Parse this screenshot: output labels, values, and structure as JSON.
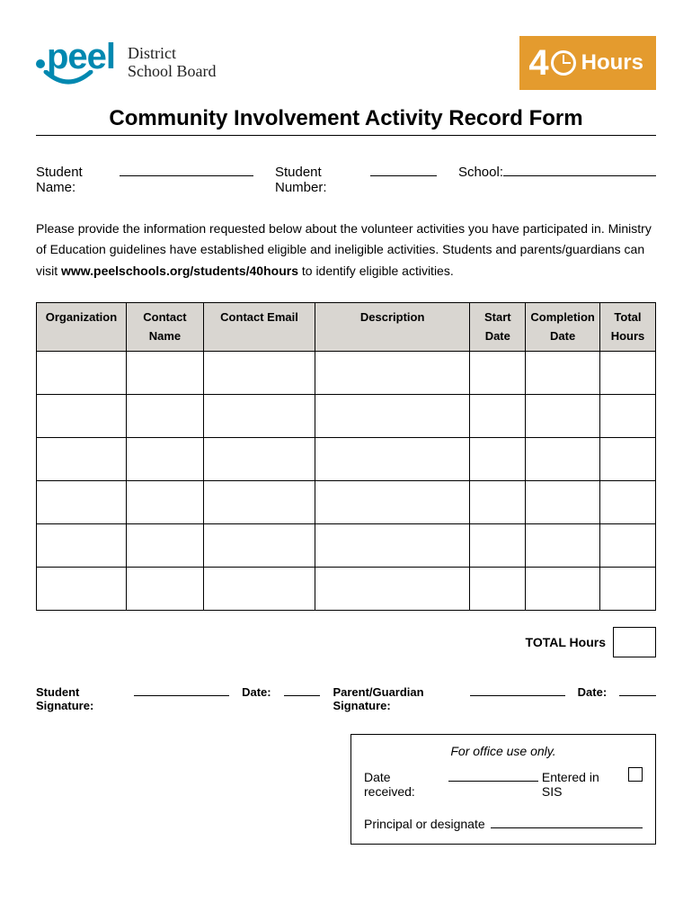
{
  "logo": {
    "peel": "peel",
    "district": "District",
    "schoolboard": "School Board"
  },
  "badge": {
    "four": "4",
    "hours": "Hours"
  },
  "title": "Community Involvement Activity Record Form",
  "fields": {
    "studentName": "Student Name:",
    "studentNumber": "Student Number:",
    "school": "School:"
  },
  "instructions": {
    "part1": "Please provide the information requested below about the volunteer activities you have participated in.  Ministry of Education guidelines have established eligible and ineligible activities. Students and parents/guardians can visit ",
    "bold": "www.peelschools.org/students/40hours",
    "part2": " to identify eligible activities."
  },
  "table": {
    "headers": {
      "org": "Organization",
      "contact": "Contact Name",
      "email": "Contact Email",
      "desc": "Description",
      "start": "Start Date",
      "comp": "Completion Date",
      "total": "Total Hours"
    }
  },
  "totalLabel": "TOTAL Hours",
  "signatures": {
    "student": "Student Signature:",
    "date1": "Date:",
    "parent": "Parent/Guardian Signature:",
    "date2": "Date:"
  },
  "office": {
    "title": "For office use only.",
    "dateReceived": "Date received:",
    "enteredSIS": "Entered in SIS",
    "principal": "Principal or designate"
  }
}
